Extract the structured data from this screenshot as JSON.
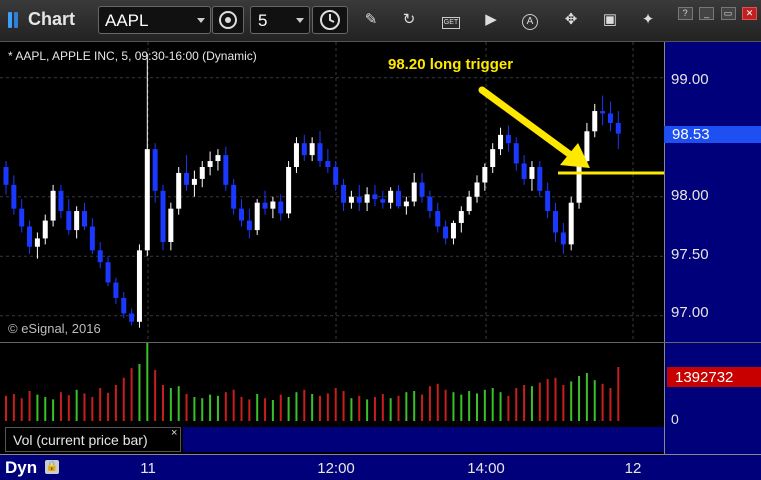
{
  "window": {
    "title": "Chart"
  },
  "toolbar": {
    "symbol": "AAPL",
    "interval": "5",
    "icons": [
      "symbol-settings-icon",
      "clock-icon",
      "pencil-icon",
      "refresh-icon",
      "get-icon",
      "play-icon",
      "alert-icon",
      "tools-icon",
      "tag-icon",
      "twitter-icon"
    ],
    "labels": {
      "get": "GET",
      "alert": "A"
    }
  },
  "window_controls": {
    "help": "?",
    "minimize": "_",
    "maximize": "▭",
    "close": "✕"
  },
  "chart": {
    "header": "* AAPL, APPLE INC, 5, 09:30-16:00 (Dynamic)",
    "copyright": "© eSignal, 2016",
    "annotation": "98.20 long trigger",
    "trigger_price": 98.2,
    "last_price": "98.53",
    "price_ticks": [
      "99.00",
      "98.00",
      "97.50",
      "97.00"
    ],
    "price_tick_values": [
      99.0,
      98.0,
      97.5,
      97.0
    ],
    "time_labels": [
      "11",
      "12:00",
      "14:00",
      "12"
    ],
    "footer_label": "Dyn",
    "colors": {
      "up": "#ffffff",
      "down": "#1a38ff",
      "vol_up": "#39c02a",
      "vol_down": "#c81e1e",
      "annotation": "#ffe800",
      "scale_bg": "#00007a",
      "last_price_bg": "#1e4ff0"
    }
  },
  "volume": {
    "legend": "Vol (current price bar)",
    "close": "×",
    "last_value": "1392732",
    "zero_label": "0"
  },
  "chart_data": {
    "type": "candlestick",
    "ylim": [
      96.78,
      99.3
    ],
    "bars": [
      [
        98.25,
        98.3,
        98.02,
        98.1
      ],
      [
        98.1,
        98.18,
        97.85,
        97.9
      ],
      [
        97.9,
        97.98,
        97.7,
        97.75
      ],
      [
        97.75,
        97.8,
        97.52,
        97.58
      ],
      [
        97.58,
        97.7,
        97.48,
        97.65
      ],
      [
        97.65,
        97.85,
        97.6,
        97.8
      ],
      [
        97.8,
        98.1,
        97.75,
        98.05
      ],
      [
        98.05,
        98.1,
        97.82,
        97.88
      ],
      [
        97.88,
        97.98,
        97.68,
        97.72
      ],
      [
        97.72,
        97.92,
        97.65,
        97.88
      ],
      [
        97.88,
        97.95,
        97.72,
        97.75
      ],
      [
        97.75,
        97.82,
        97.52,
        97.55
      ],
      [
        97.55,
        97.62,
        97.4,
        97.45
      ],
      [
        97.45,
        97.5,
        97.25,
        97.28
      ],
      [
        97.28,
        97.32,
        97.1,
        97.15
      ],
      [
        97.15,
        97.2,
        96.98,
        97.02
      ],
      [
        97.02,
        97.06,
        96.92,
        96.95
      ],
      [
        96.95,
        97.6,
        96.9,
        97.55
      ],
      [
        97.55,
        99.2,
        97.5,
        98.4
      ],
      [
        98.4,
        98.45,
        97.95,
        98.05
      ],
      [
        98.05,
        98.1,
        97.55,
        97.62
      ],
      [
        97.62,
        97.95,
        97.55,
        97.9
      ],
      [
        97.9,
        98.25,
        97.85,
        98.2
      ],
      [
        98.2,
        98.35,
        98.05,
        98.1
      ],
      [
        98.1,
        98.22,
        98.0,
        98.15
      ],
      [
        98.15,
        98.3,
        98.08,
        98.25
      ],
      [
        98.25,
        98.38,
        98.18,
        98.3
      ],
      [
        98.3,
        98.4,
        98.22,
        98.35
      ],
      [
        98.35,
        98.42,
        98.05,
        98.1
      ],
      [
        98.1,
        98.15,
        97.85,
        97.9
      ],
      [
        97.9,
        97.98,
        97.75,
        97.8
      ],
      [
        97.8,
        97.9,
        97.65,
        97.72
      ],
      [
        97.72,
        97.98,
        97.68,
        97.95
      ],
      [
        97.95,
        98.05,
        97.85,
        97.9
      ],
      [
        97.9,
        98.0,
        97.82,
        97.96
      ],
      [
        97.96,
        98.02,
        97.8,
        97.86
      ],
      [
        97.86,
        98.3,
        97.82,
        98.25
      ],
      [
        98.25,
        98.5,
        98.2,
        98.45
      ],
      [
        98.45,
        98.52,
        98.3,
        98.35
      ],
      [
        98.35,
        98.5,
        98.3,
        98.45
      ],
      [
        98.45,
        98.55,
        98.25,
        98.3
      ],
      [
        98.3,
        98.4,
        98.2,
        98.25
      ],
      [
        98.25,
        98.3,
        98.05,
        98.1
      ],
      [
        98.1,
        98.15,
        97.88,
        97.95
      ],
      [
        97.95,
        98.05,
        97.9,
        98.0
      ],
      [
        98.0,
        98.1,
        97.88,
        97.95
      ],
      [
        97.95,
        98.08,
        97.88,
        98.02
      ],
      [
        98.02,
        98.1,
        97.92,
        97.98
      ],
      [
        97.98,
        98.05,
        97.9,
        97.95
      ],
      [
        97.95,
        98.08,
        97.9,
        98.05
      ],
      [
        98.05,
        98.1,
        97.9,
        97.92
      ],
      [
        97.92,
        98.0,
        97.85,
        97.96
      ],
      [
        97.96,
        98.2,
        97.92,
        98.12
      ],
      [
        98.12,
        98.2,
        97.95,
        98.0
      ],
      [
        98.0,
        98.05,
        97.82,
        97.88
      ],
      [
        97.88,
        97.95,
        97.7,
        97.75
      ],
      [
        97.75,
        97.8,
        97.6,
        97.65
      ],
      [
        97.65,
        97.8,
        97.6,
        97.78
      ],
      [
        97.78,
        97.92,
        97.7,
        97.88
      ],
      [
        97.88,
        98.05,
        97.85,
        98.0
      ],
      [
        98.0,
        98.18,
        97.95,
        98.12
      ],
      [
        98.12,
        98.28,
        98.05,
        98.25
      ],
      [
        98.25,
        98.45,
        98.2,
        98.4
      ],
      [
        98.4,
        98.58,
        98.35,
        98.52
      ],
      [
        98.52,
        98.6,
        98.38,
        98.45
      ],
      [
        98.45,
        98.5,
        98.22,
        98.28
      ],
      [
        98.28,
        98.35,
        98.1,
        98.15
      ],
      [
        98.15,
        98.3,
        98.05,
        98.25
      ],
      [
        98.25,
        98.3,
        98.0,
        98.05
      ],
      [
        98.05,
        98.12,
        97.82,
        97.88
      ],
      [
        97.88,
        97.95,
        97.62,
        97.7
      ],
      [
        97.7,
        97.78,
        97.52,
        97.6
      ],
      [
        97.6,
        98.0,
        97.55,
        97.95
      ],
      [
        97.95,
        98.35,
        97.9,
        98.3
      ],
      [
        98.3,
        98.62,
        98.25,
        98.55
      ],
      [
        98.55,
        98.78,
        98.5,
        98.72
      ],
      [
        98.72,
        98.85,
        98.6,
        98.7
      ],
      [
        98.7,
        98.8,
        98.55,
        98.62
      ],
      [
        98.62,
        98.72,
        98.4,
        98.53
      ]
    ],
    "volume": [
      42,
      45,
      38,
      50,
      44,
      40,
      36,
      48,
      43,
      52,
      46,
      40,
      55,
      47,
      60,
      72,
      88,
      95,
      130,
      85,
      60,
      55,
      58,
      45,
      40,
      38,
      44,
      42,
      48,
      52,
      40,
      36,
      45,
      38,
      35,
      44,
      40,
      48,
      52,
      45,
      42,
      46,
      55,
      50,
      38,
      42,
      36,
      40,
      45,
      38,
      42,
      48,
      50,
      44,
      58,
      62,
      52,
      48,
      44,
      50,
      46,
      52,
      55,
      48,
      42,
      55,
      60,
      58,
      64,
      70,
      72,
      60,
      66,
      75,
      80,
      68,
      62,
      55,
      90
    ]
  }
}
